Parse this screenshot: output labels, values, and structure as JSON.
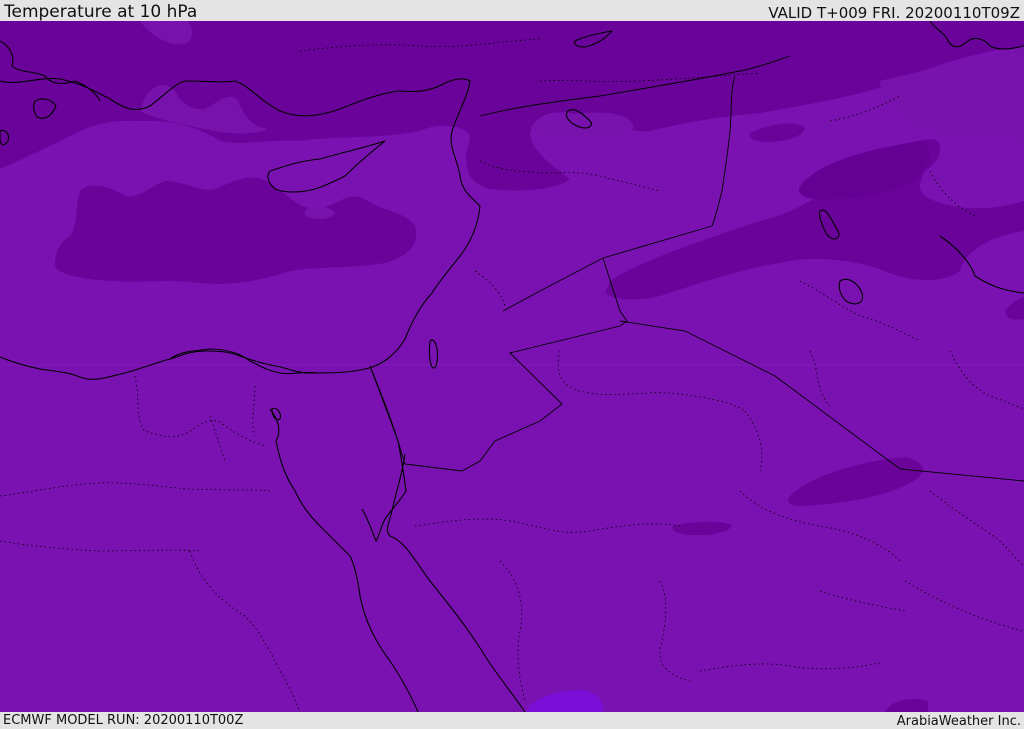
{
  "header": {
    "title": "Temperature at 10 hPa",
    "valid_time": "VALID T+009 FRI. 20200110T09Z"
  },
  "footer": {
    "model_run": "ECMWF MODEL RUN: 20200110T00Z",
    "credit": "ArabiaWeather Inc."
  },
  "map": {
    "colors": {
      "base_band": "#7a12b2",
      "cold_band": "#6a0399",
      "coldest_band": "#62008f",
      "warm_band": "#7a10d8",
      "borders": "#000000"
    }
  }
}
